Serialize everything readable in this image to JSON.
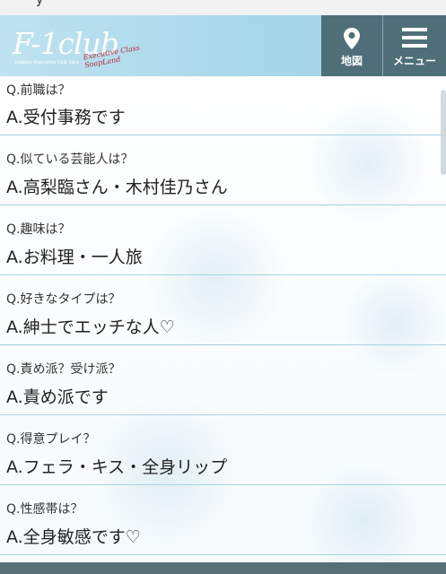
{
  "top_strip": {
    "text": "y"
  },
  "header": {
    "logo": {
      "wordmark": "F-1club",
      "subtitle": "shabaru Executive Club Sara",
      "script_line1": "Executive Class",
      "script_line2": "SoapLand"
    },
    "nav": {
      "map_label": "地図",
      "menu_label": "メニュー"
    }
  },
  "qa": [
    {
      "q": "Q.前職は？",
      "a": "A.受付事務です"
    },
    {
      "q": "Q.似ている芸能人は？",
      "a": "A.高梨臨さん・木村佳乃さん"
    },
    {
      "q": "Q.趣味は？",
      "a": "A.お料理・一人旅"
    },
    {
      "q": "Q.好きなタイプは？",
      "a": "A.紳士でエッチな人♡"
    },
    {
      "q": "Q.責め派？受け派？",
      "a": "A.責め派です"
    },
    {
      "q": "Q.得意プレイ？",
      "a": "A.フェラ・キス・全身リップ"
    },
    {
      "q": "Q.性感帯は？",
      "a": "A.全身敏感です♡"
    }
  ],
  "colors": {
    "header_bg": "#a9d7ea",
    "nav_button_bg": "#4f6f78",
    "divider": "#a8d3e2",
    "logo_accent": "#c0243a"
  },
  "icons": [
    "map-pin-icon",
    "hamburger-menu-icon"
  ]
}
